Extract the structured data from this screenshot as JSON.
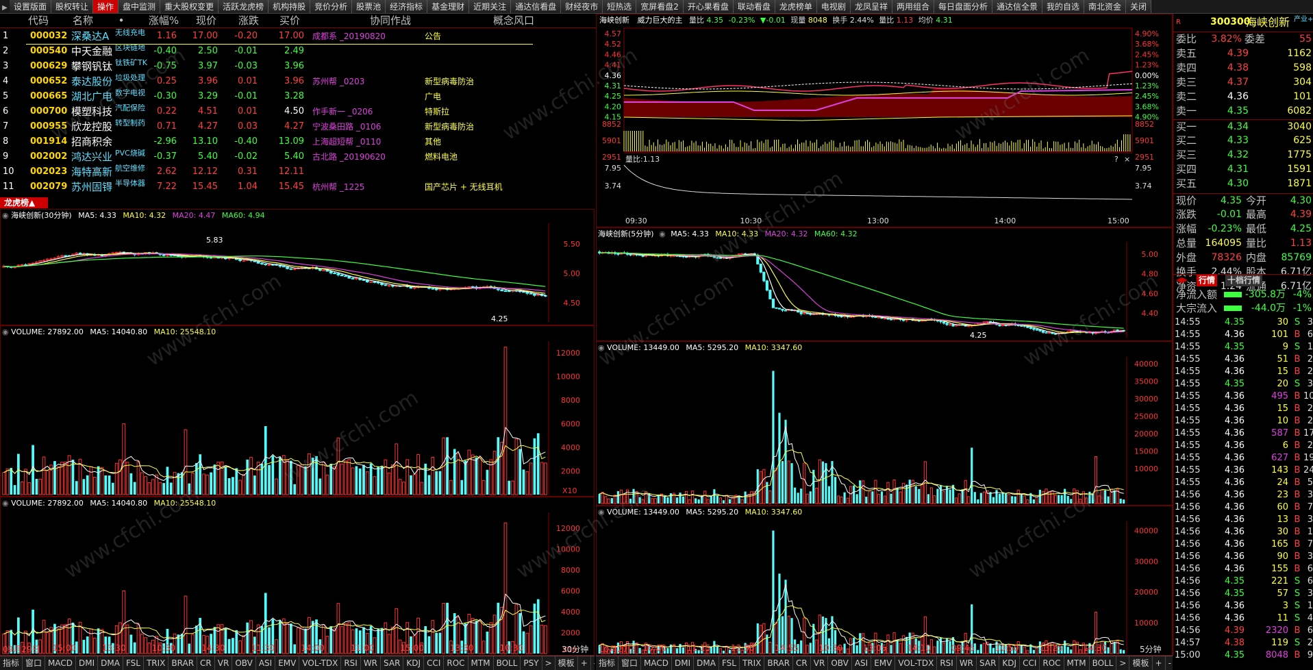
{
  "top_tabs": [
    "设置版面",
    "股权转让",
    "操作",
    "盘中监测",
    "重大股权变更",
    "活跃龙虎榜",
    "机构持股",
    "竞价分析",
    "股票池",
    "经济指标",
    "基金理财",
    "近期关注",
    "通达信看盘",
    "财经夜市",
    "短热选",
    "宽屏看盘2",
    "开心果看盘",
    "联动看盘",
    "龙虎榜单",
    "电视剧",
    "龙凤呈祥",
    "两用组合",
    "每日盘面分析",
    "通达信全景",
    "我的自选",
    "南北资金",
    "关闭"
  ],
  "top_active": 2,
  "table": {
    "headers": [
      "代码",
      "名称",
      "•",
      "涨幅%",
      "现价",
      "涨跌",
      "买价",
      "协同作战",
      "概念风口"
    ],
    "rows": [
      {
        "idx": "1",
        "code": "000032",
        "name": "深桑达A",
        "tag": "无线充电",
        "pct": "1.16",
        "now": "17.00",
        "chg": "-0.20",
        "bid": "17.00",
        "team": "成都系 _20190820",
        "concept": "公告",
        "dir": "up",
        "tagcolor": "cy",
        "namecolor": "cy"
      },
      {
        "idx": "2",
        "code": "000540",
        "name": "中天金融",
        "tag": "区块链地",
        "pct": "-0.40",
        "now": "2.50",
        "chg": "-0.01",
        "bid": "2.49",
        "team": "",
        "concept": "",
        "dir": "dn",
        "tagcolor": "cy",
        "namecolor": "fl"
      },
      {
        "idx": "3",
        "code": "000629",
        "name": "攀钢钒钛",
        "tag": "钛铁矿TK",
        "pct": "-0.75",
        "now": "3.97",
        "chg": "-0.03",
        "bid": "3.96",
        "team": "",
        "concept": "",
        "dir": "dn",
        "tagcolor": "cy",
        "namecolor": "fl"
      },
      {
        "idx": "4",
        "code": "000652",
        "name": "泰达股份",
        "tag": "垃圾处理",
        "pct": "0.25",
        "now": "3.96",
        "chg": "0.01",
        "bid": "3.96",
        "team": "苏州帮 _0203",
        "concept": "新型病毒防治",
        "dir": "up",
        "tagcolor": "cy",
        "namecolor": "cy"
      },
      {
        "idx": "5",
        "code": "000665",
        "name": "湖北广电",
        "tag": "数字电视",
        "pct": "-0.30",
        "now": "3.29",
        "chg": "-0.01",
        "bid": "3.28",
        "team": "",
        "concept": "广电",
        "dir": "dn",
        "tagcolor": "cy",
        "namecolor": "cy"
      },
      {
        "idx": "6",
        "code": "000700",
        "name": "模塑科技",
        "tag": "汽配保险",
        "pct": "0.22",
        "now": "4.51",
        "chg": "0.01",
        "bid": "4.50",
        "team": "作手新一 _0206",
        "concept": "特斯拉",
        "dir": "up",
        "tagcolor": "cy",
        "namecolor": "fl"
      },
      {
        "idx": "7",
        "code": "000955",
        "name": "欣龙控股",
        "tag": "转型制药",
        "pct": "0.71",
        "now": "4.27",
        "chg": "0.03",
        "bid": "4.27",
        "team": "宁波桑田路 _0106",
        "concept": "新型病毒防治",
        "dir": "up",
        "tagcolor": "cy",
        "namecolor": "fl"
      },
      {
        "idx": "8",
        "code": "001914",
        "name": "招商积余",
        "tag": "",
        "pct": "-2.96",
        "now": "13.10",
        "chg": "-0.40",
        "bid": "13.09",
        "team": "上海超短帮 _0110",
        "concept": "其他",
        "dir": "dn",
        "tagcolor": "cy",
        "namecolor": "fl"
      },
      {
        "idx": "9",
        "code": "002002",
        "name": "鸿达兴业",
        "tag": "PVC烧碱",
        "pct": "-0.37",
        "now": "5.40",
        "chg": "-0.02",
        "bid": "5.40",
        "team": "古北路 _20190620",
        "concept": "燃料电池",
        "dir": "dn",
        "tagcolor": "cy",
        "namecolor": "cy"
      },
      {
        "idx": "10",
        "code": "002023",
        "name": "海特高新",
        "tag": "航空维修",
        "pct": "2.62",
        "now": "12.12",
        "chg": "0.31",
        "bid": "12.11",
        "team": "",
        "concept": "",
        "dir": "up",
        "tagcolor": "cy",
        "namecolor": "cy"
      },
      {
        "idx": "11",
        "code": "002079",
        "name": "苏州固锝",
        "tag": "半导体器",
        "pct": "7.22",
        "now": "15.45",
        "chg": "1.04",
        "bid": "15.45",
        "team": "杭州帮 _1225",
        "concept": "国产芯片 + 无线耳机",
        "dir": "up",
        "tagcolor": "cy",
        "namecolor": "cy"
      }
    ]
  },
  "lhb_label": "龙虎榜▲",
  "charts": {
    "k30": {
      "title": "海峡创新(30分钟)",
      "ma5": "MA5: 4.33",
      "ma10": "MA10: 4.32",
      "ma20": "MA20: 4.47",
      "ma60": "MA60: 4.94",
      "hi_label": "5.83",
      "lo_label": "4.25",
      "yticks": [
        "5.50",
        "5.00",
        "4.50"
      ]
    },
    "k5": {
      "title": "海峡创新(5分钟)",
      "ma5": "MA5: 4.33",
      "ma10": "MA10: 4.33",
      "ma20": "MA20: 4.32",
      "ma60": "MA60: 4.32",
      "lo_label": "4.25",
      "yticks": [
        "5.00",
        "4.80",
        "4.60",
        "4.40"
      ]
    },
    "vol30a": {
      "label": "VOLUME: 27892.00",
      "ma5": "MA5: 14040.80",
      "ma10": "MA10: 25548.10",
      "yticks": [
        "12000",
        "10000",
        "8000",
        "6000",
        "4000",
        "2000"
      ],
      "unit": "X10"
    },
    "vol30b": {
      "label": "VOLUME: 27892.00",
      "ma5": "MA5: 14040.80",
      "ma10": "MA10: 25548.10",
      "yticks": [
        "12000",
        "10000",
        "8000",
        "6000",
        "4000",
        "2000"
      ],
      "unit": "X10"
    },
    "vol5a": {
      "label": "VOLUME: 13449.00",
      "ma5": "MA5: 5295.20",
      "ma10": "MA10: 3347.60",
      "yticks": [
        "40000",
        "35000",
        "30000",
        "25000",
        "20000",
        "15000",
        "10000"
      ]
    },
    "vol5b": {
      "label": "VOLUME: 13449.00",
      "ma5": "MA5: 5295.20",
      "ma10": "MA10: 3347.60",
      "yticks": [
        "40000",
        "30000",
        "20000",
        "10000"
      ]
    },
    "intraday": {
      "name": "海峡创新",
      "slogan": "威力巨大的主",
      "qty_ratio_label": "量比",
      "qty_ratio_val": "4.35",
      "pct": "-0.23%",
      "chg": "▼-0.01",
      "vol_label": "现量",
      "vol": "8048",
      "turnover_label": "换手",
      "turnover": "2.44%",
      "lb_label": "量比",
      "lb": "1.13",
      "avg_label": "均价",
      "avg": "4.31",
      "left_ticks": [
        "4.57",
        "4.52",
        "4.46",
        "4.41",
        "4.36",
        "4.31",
        "4.25",
        "4.20",
        "4.15"
      ],
      "right_ticks": [
        "4.90%",
        "3.68%",
        "2.45%",
        "1.23%",
        "0.00%",
        "1.23%",
        "2.45%",
        "3.68%",
        "4.90%"
      ],
      "vol_ticks": [
        "8852",
        "5901",
        "2951"
      ],
      "ratio_label": "量比:1.13",
      "ratio_ticks": [
        "7.95",
        "3.74"
      ],
      "times": [
        "09:30",
        "10:30",
        "13:00",
        "14:00",
        "15:00"
      ]
    }
  },
  "bottom_left": [
    "指标",
    "窗口",
    "MACD",
    "DMI",
    "DMA",
    "FSL",
    "TRIX",
    "BRAR",
    "CR",
    "VR",
    "OBV",
    "ASI",
    "EMV",
    "VOL-TDX",
    "RSI",
    "WR",
    "SAR",
    "KDJ",
    "CCI",
    "ROC",
    "MTM",
    "BOLL",
    "PSY",
    ">",
    "模板",
    "+",
    "-",
    "Z"
  ],
  "bottom_right": [
    "指标",
    "窗口",
    "MACD",
    "DMI",
    "DMA",
    "FSL",
    "TRIX",
    "BRAR",
    "CR",
    "VR",
    "OBV",
    "ASI",
    "EMV",
    "VOL-TDX",
    "RSI",
    "WR",
    "SAR",
    "KDJ",
    "CCI",
    "ROC",
    "MTM",
    "BOLL",
    ">",
    "模板",
    "+",
    "-",
    "Z"
  ],
  "x_dates_left": [
    "09月29日",
    "15:00",
    "13:30",
    "10:30",
    "14:30",
    "11:30",
    "14:00",
    "11:00",
    "15:00",
    "13:30",
    "10:30",
    "30分钟"
  ],
  "x_dates_right": [
    "10月27日",
    "10:00",
    "11:15",
    "13:50",
    "14:55",
    "10:30",
    "13:05",
    "14:10",
    "09:45",
    "10:50",
    "13:25",
    "14:30",
    "5分钟"
  ],
  "right_panel": {
    "code": "300300",
    "name": "海峡创新",
    "tag": "产业+",
    "webi_label": "委比",
    "webi": "3.82%",
    "weicha_label": "委差",
    "weicha": "55",
    "asks": [
      {
        "l": "卖五",
        "p": "4.39",
        "v": "1162"
      },
      {
        "l": "卖四",
        "p": "4.38",
        "v": "598"
      },
      {
        "l": "卖三",
        "p": "4.37",
        "v": "304"
      },
      {
        "l": "卖二",
        "p": "4.36",
        "v": "101"
      },
      {
        "l": "卖一",
        "p": "4.35",
        "v": "6082"
      }
    ],
    "bids": [
      {
        "l": "买一",
        "p": "4.34",
        "v": "3040"
      },
      {
        "l": "买二",
        "p": "4.33",
        "v": "625"
      },
      {
        "l": "买三",
        "p": "4.32",
        "v": "1775"
      },
      {
        "l": "买四",
        "p": "4.31",
        "v": "1591"
      },
      {
        "l": "买五",
        "p": "4.30",
        "v": "1871"
      }
    ],
    "stats": [
      {
        "l1": "现价",
        "v1": "4.35",
        "c1": "S",
        "l2": "今开",
        "v2": "4.30",
        "c2": "S"
      },
      {
        "l1": "涨跌",
        "v1": "-0.01",
        "c1": "S",
        "l2": "最高",
        "v2": "4.39",
        "c2": "B"
      },
      {
        "l1": "涨幅",
        "v1": "-0.23%",
        "c1": "S",
        "l2": "最低",
        "v2": "4.25",
        "c2": "S"
      },
      {
        "l1": "总量",
        "v1": "164095",
        "c1": "Y",
        "l2": "量比",
        "v2": "1.13",
        "c2": "B"
      },
      {
        "l1": "外盘",
        "v1": "78326",
        "c1": "B",
        "l2": "内盘",
        "v2": "85769",
        "c2": "S"
      },
      {
        "l1": "换手",
        "v1": "2.44%",
        "c1": "W",
        "l2": "股本",
        "v2": "6.71亿",
        "c2": "W"
      },
      {
        "l1": "净资",
        "v1": "1.24",
        "c1": "W",
        "l2": "流通",
        "v2": "6.71亿",
        "c2": "W"
      }
    ],
    "tabs": [
      "行情",
      "十档行情"
    ],
    "flow": [
      {
        "l": "净流入额",
        "v": "-305.8万",
        "p": "-4%"
      },
      {
        "l": "大宗流入",
        "v": "-44.0万",
        "p": "-1%"
      }
    ],
    "ticks": [
      [
        "14:55",
        "4.35",
        "30",
        "S",
        "3"
      ],
      [
        "14:55",
        "4.36",
        "101",
        "B",
        "6"
      ],
      [
        "14:55",
        "4.35",
        "9",
        "S",
        "1"
      ],
      [
        "14:55",
        "4.36",
        "51",
        "B",
        "2"
      ],
      [
        "14:55",
        "4.36",
        "15",
        "B",
        "2"
      ],
      [
        "14:55",
        "4.35",
        "20",
        "S",
        "3"
      ],
      [
        "14:55",
        "4.36",
        "495",
        "B",
        "10"
      ],
      [
        "14:55",
        "4.36",
        "15",
        "B",
        "2"
      ],
      [
        "14:55",
        "4.36",
        "10",
        "B",
        "2"
      ],
      [
        "14:55",
        "4.36",
        "587",
        "B",
        "17"
      ],
      [
        "14:55",
        "4.36",
        "6",
        "B",
        "2"
      ],
      [
        "14:55",
        "4.36",
        "627",
        "B",
        "19"
      ],
      [
        "14:55",
        "4.36",
        "143",
        "B",
        "24"
      ],
      [
        "14:55",
        "4.36",
        "24",
        "B",
        "5"
      ],
      [
        "14:56",
        "4.36",
        "23",
        "B",
        "3"
      ],
      [
        "14:56",
        "4.36",
        "60",
        "B",
        "7"
      ],
      [
        "14:56",
        "4.36",
        "13",
        "B",
        "3"
      ],
      [
        "14:56",
        "4.36",
        "30",
        "B",
        "1"
      ],
      [
        "14:56",
        "4.36",
        "165",
        "B",
        "7"
      ],
      [
        "14:56",
        "4.36",
        "90",
        "B",
        "3"
      ],
      [
        "14:56",
        "4.36",
        "155",
        "B",
        "6"
      ],
      [
        "14:56",
        "4.35",
        "221",
        "S",
        "6"
      ],
      [
        "14:56",
        "4.35",
        "57",
        "S",
        "3"
      ],
      [
        "14:56",
        "4.36",
        "3",
        "S",
        "1"
      ],
      [
        "14:56",
        "4.36",
        "11",
        "S",
        "4"
      ],
      [
        "14:56",
        "4.39",
        "2320",
        "B",
        "6"
      ],
      [
        "14:57",
        "4.38",
        "119",
        "S",
        "2"
      ],
      [
        "15:00",
        "4.35",
        "8048",
        "B",
        "9"
      ]
    ]
  },
  "watermark": "www.cfchi.com"
}
